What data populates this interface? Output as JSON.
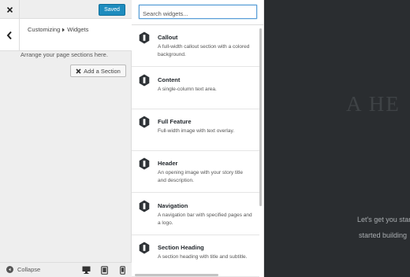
{
  "topbar": {
    "close_label": "Close",
    "saved_label": "Saved"
  },
  "header": {
    "breadcrumb_root": "Customizing",
    "breadcrumb_current": "Widgets"
  },
  "panel": {
    "description": "Arrange your page sections here.",
    "add_section_label": "Add a Section"
  },
  "footer": {
    "collapse_label": "Collapse",
    "devices": [
      "desktop",
      "tablet",
      "mobile"
    ]
  },
  "search": {
    "placeholder": "Search widgets..."
  },
  "widgets": [
    {
      "title": "Callout",
      "description": "A full-width callout section with a colored background.",
      "icon": "widget-hex-icon"
    },
    {
      "title": "Content",
      "description": "A single-column text area.",
      "icon": "widget-hex-icon"
    },
    {
      "title": "Full Feature",
      "description": "Full-width image with text overlay.",
      "icon": "widget-hex-icon"
    },
    {
      "title": "Header",
      "description": "An opening image with your story title and description.",
      "icon": "widget-hex-icon"
    },
    {
      "title": "Navigation",
      "description": "A navigation bar with specified pages and a logo.",
      "icon": "widget-hex-icon"
    },
    {
      "title": "Section Heading",
      "description": "A section heading with title and subtitle.",
      "icon": "widget-hex-icon"
    }
  ],
  "preview": {
    "hero_title": "A HE",
    "line1": "Let's get you star",
    "line2": "started building"
  },
  "colors": {
    "accent": "#1e8cbe",
    "preview_bg": "#2a2d30",
    "panel_bg": "#eeeeee"
  }
}
